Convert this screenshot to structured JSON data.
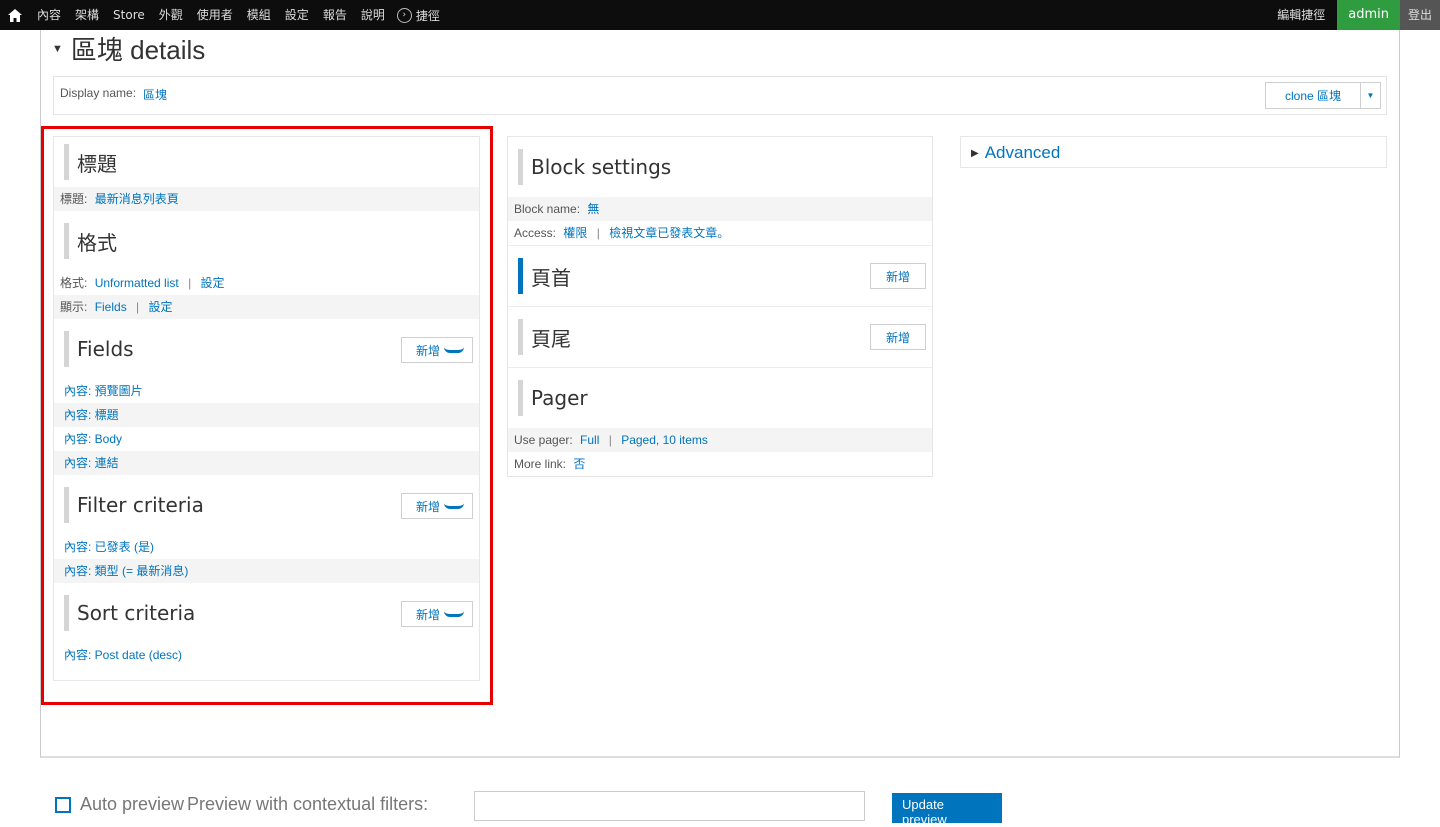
{
  "toolbar": {
    "menu": [
      "內容",
      "架構",
      "Store",
      "外觀",
      "使用者",
      "模組",
      "設定",
      "報告",
      "說明"
    ],
    "shortcuts": "捷徑",
    "edit_shortcuts": "編輯捷徑",
    "user": "admin",
    "logout": "登出"
  },
  "page": {
    "title": "區塊 details",
    "display_name_label": "Display name:",
    "display_name": "區塊",
    "clone_button": "clone 區塊"
  },
  "column1": {
    "title_section": {
      "heading": "標題",
      "label": "標題:",
      "value": "最新消息列表頁"
    },
    "format_section": {
      "heading": "格式",
      "format_label": "格式:",
      "format_value": "Unformatted list",
      "format_settings": "設定",
      "show_label": "顯示:",
      "show_value": "Fields",
      "show_settings": "設定"
    },
    "fields_section": {
      "heading": "Fields",
      "add": "新增",
      "items": [
        "內容: 預覽圖片",
        "內容: 標題",
        "內容: Body",
        "內容: 連結"
      ]
    },
    "filter_section": {
      "heading": "Filter criteria",
      "add": "新增",
      "items": [
        "內容: 已發表 (是)",
        "內容: 類型 (= 最新消息)"
      ]
    },
    "sort_section": {
      "heading": "Sort criteria",
      "add": "新增",
      "items": [
        "內容: Post date (desc)"
      ]
    }
  },
  "column2": {
    "block_settings": {
      "heading": "Block settings",
      "block_name_label": "Block name:",
      "block_name_value": "無",
      "access_label": "Access:",
      "access_value1": "權限",
      "access_value2": "檢視文章已發表文章。"
    },
    "header_section": {
      "heading": "頁首",
      "add": "新增"
    },
    "footer_section": {
      "heading": "頁尾",
      "add": "新增"
    },
    "pager_section": {
      "heading": "Pager",
      "use_pager_label": "Use pager:",
      "use_pager_value1": "Full",
      "use_pager_value2": "Paged, 10 items",
      "more_link_label": "More link:",
      "more_link_value": "否"
    }
  },
  "column3": {
    "advanced": "Advanced"
  },
  "bottom": {
    "auto_preview": "Auto preview",
    "preview_label": "Preview with contextual filters:",
    "update_button": "Update preview"
  },
  "colors": {
    "link": "#0074bd",
    "highlight": "#e60000",
    "admin_green": "#2f9c3f"
  }
}
